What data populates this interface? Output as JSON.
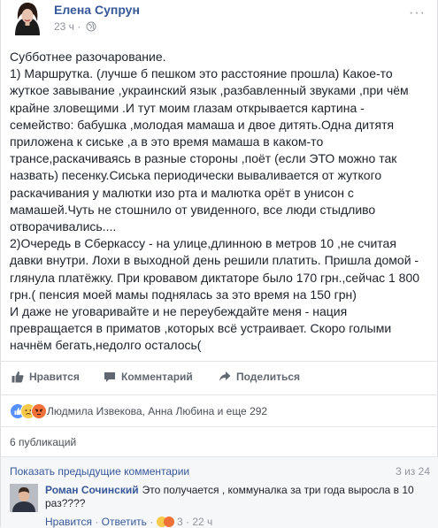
{
  "post": {
    "author": "Елена Супрун",
    "time": "23 ч",
    "separator": "·",
    "more": "···",
    "lines": [
      "Субботнее разочарование.",
      "1) Маршрутка. (лучше б пешком это расстояние прошла) Какое-то",
      "жуткое завывание ,украинский язык ,разбавленный звуками ,при чём",
      "крайне зловещими .И тут моим глазам открывается картина -",
      "семейство: бабушка ,молодая мамаша и двое дитять.Одна дитятя",
      "приложена к сиське ,а в это время мамаша в каком-то",
      "трансе,раскачиваясь в разные стороны ,поёт (если ЭТО можно так",
      "назвать) песенку.Сиська периодически вываливается от жуткого",
      "раскачивания у малютки изо рта и малютка орёт в унисон с",
      "мамашей.Чуть не стошнило от увиденного, все люди стыдливо",
      "отворачивались....",
      "2)Очередь в Сберкассу - на улице,длинною в метров 10 ,не считая",
      "давки внутри. Лохи в выходной день решили платить. Пришла домой -",
      "глянула платёжку. При кровавом диктаторе было 170 грн.,сейчас 1 800",
      "грн.( пенсия моей мамы поднялась за это время на 150 грн)",
      "И даже не уговаривайте и не переубеждайте меня - нация",
      "превращается в приматов ,которых всё устраивает. Скоро голыми",
      "начнём бегать,недолго осталось("
    ]
  },
  "actions": {
    "like": "Нравится",
    "comment": "Комментарий",
    "share": "Поделиться"
  },
  "reactions": {
    "names": "Людмила Извекова, Анна Любина и еще 292",
    "icons": [
      "like",
      "sad",
      "angry"
    ]
  },
  "shares": {
    "label": "6 публикаций"
  },
  "comments": {
    "previous_link": "Показать предыдущие комментарии",
    "counter": "3 из 24",
    "item": {
      "author": "Роман Сочинский",
      "text_line1": "Это получается , коммуналка за три года выросла в 10",
      "text_line2": "раз????",
      "like": "Нравится",
      "sep": "·",
      "reply": "Ответить",
      "reaction_count": "3",
      "time": "22 ч"
    }
  },
  "colors": {
    "link": "#365899",
    "meta": "#90949c",
    "text": "#1d2129",
    "like": "#5890ff",
    "sad": "#f7c94a",
    "angry": "#f07038"
  }
}
